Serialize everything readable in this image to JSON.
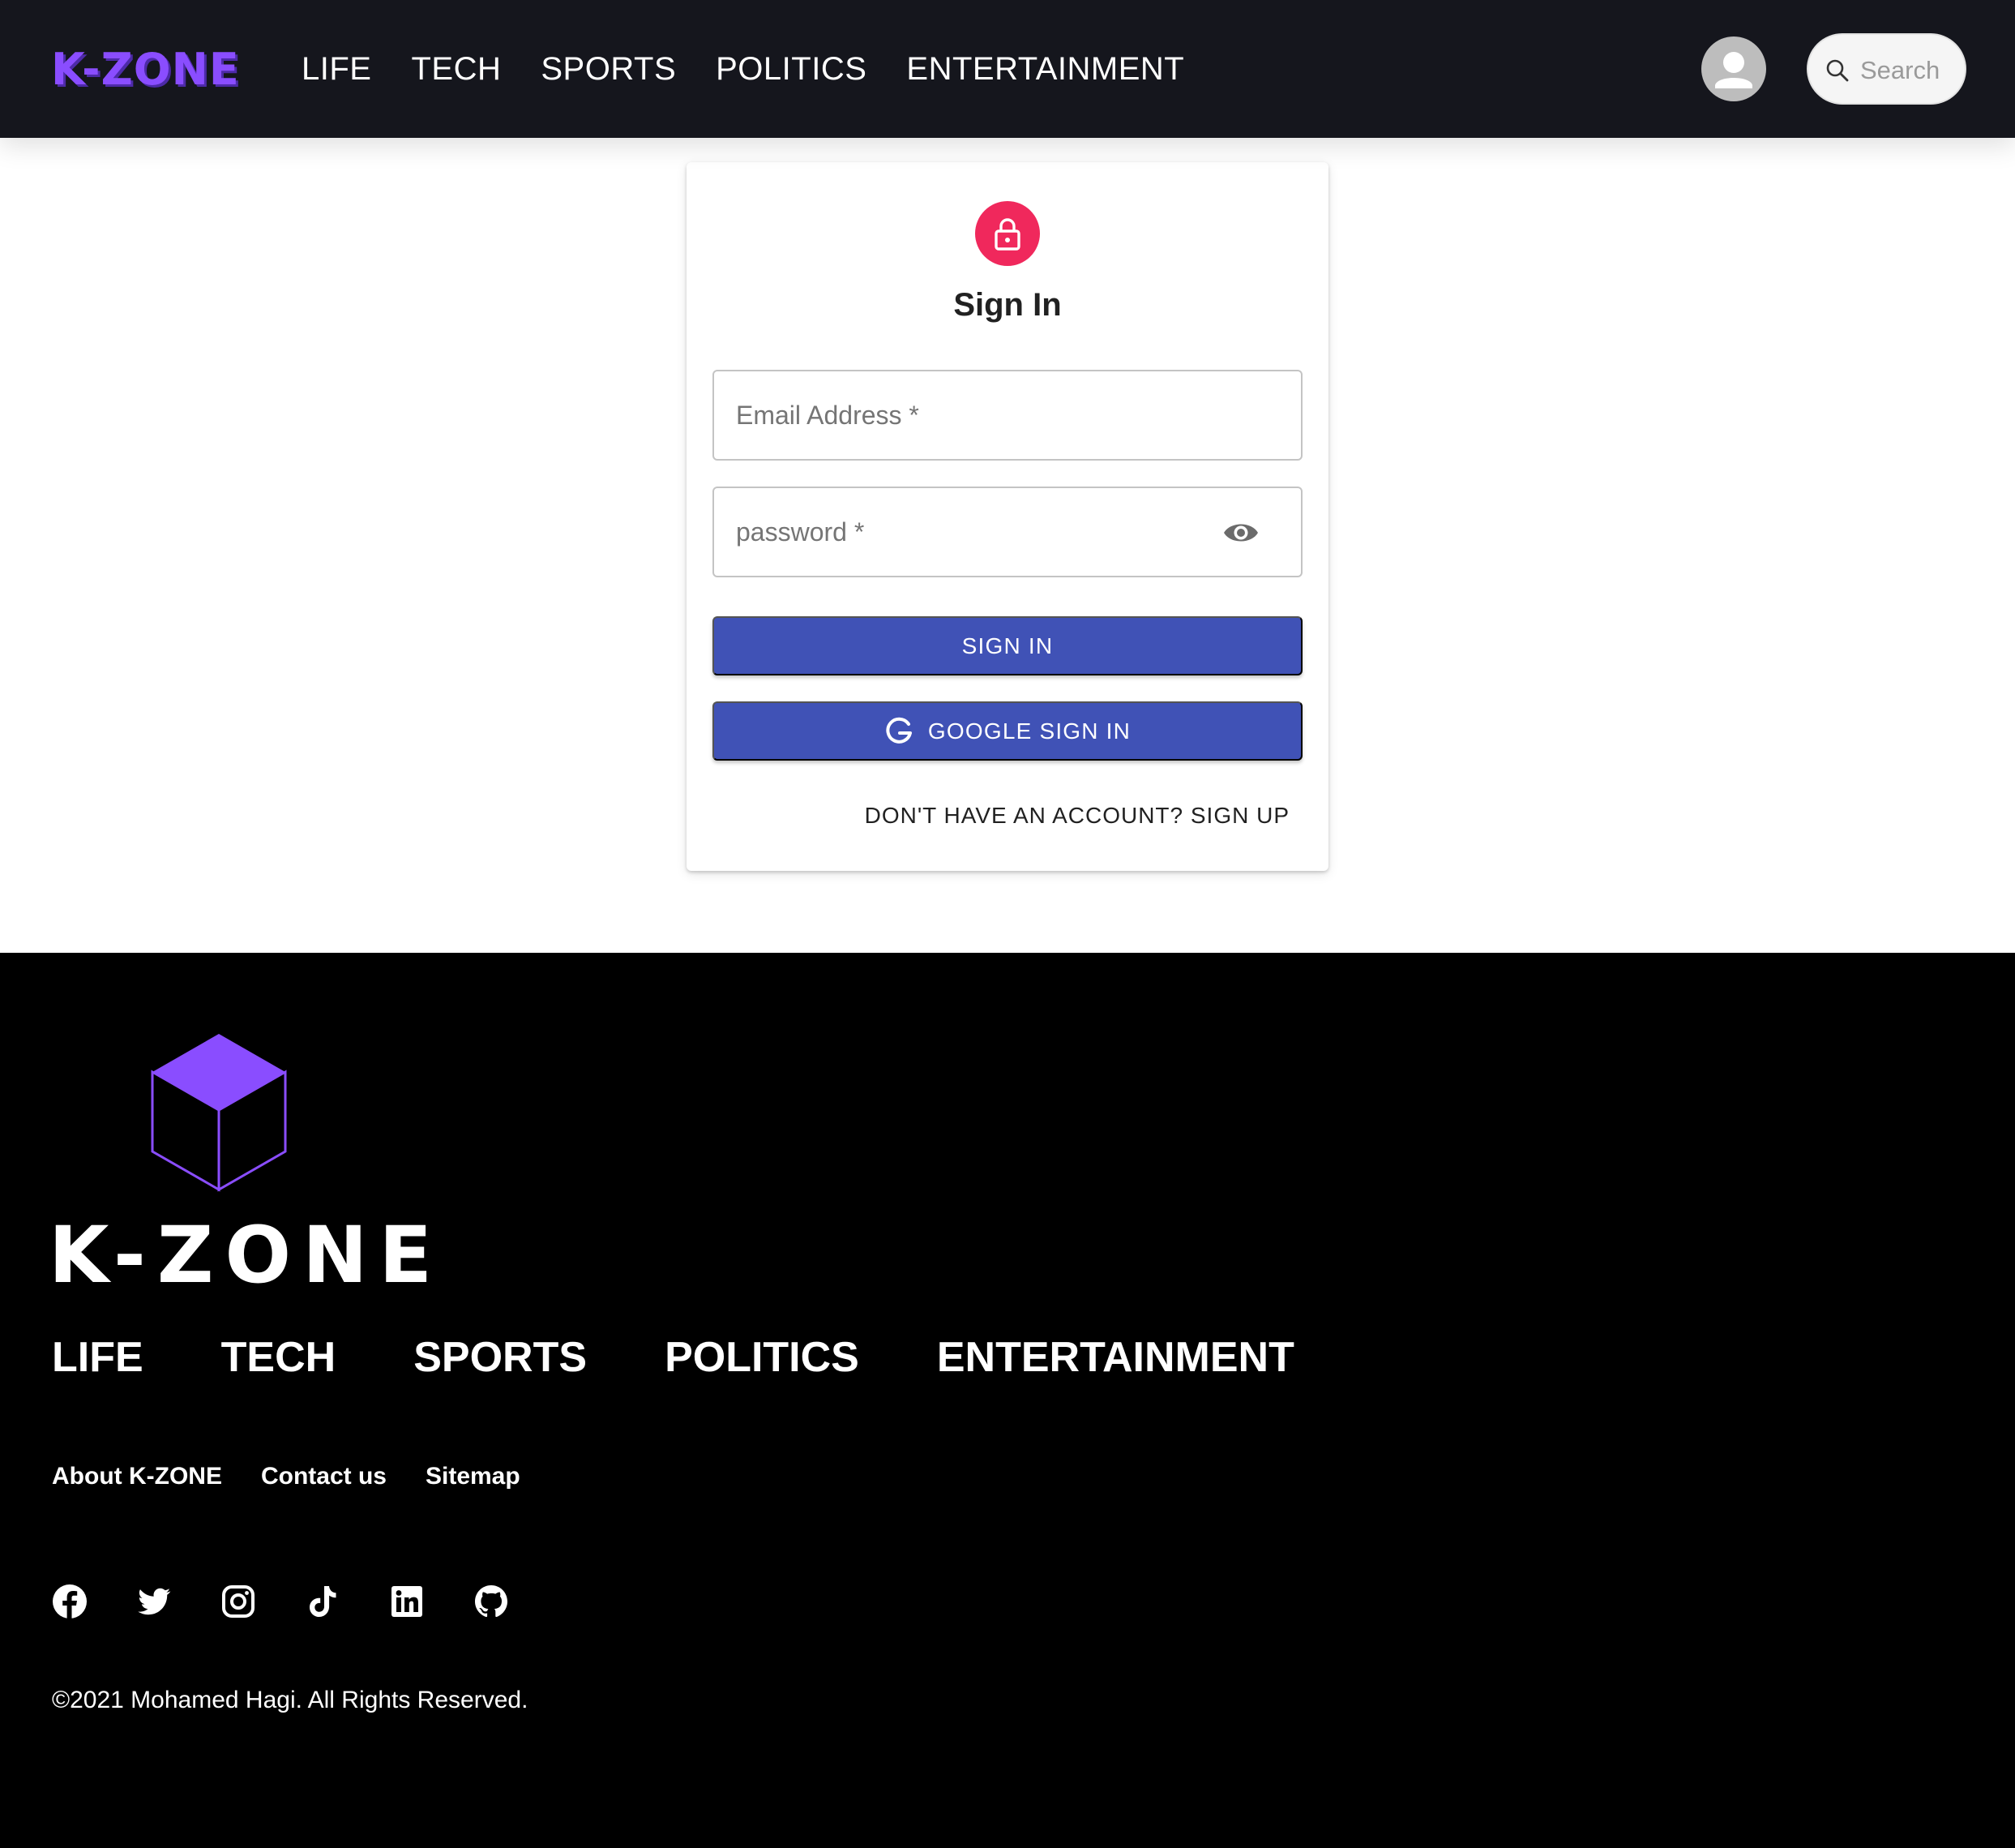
{
  "header": {
    "logo": "K-ZONE",
    "nav": [
      "LIFE",
      "TECH",
      "SPORTS",
      "POLITICS",
      "ENTERTAINMENT"
    ],
    "search_placeholder": "Search",
    "icons": {
      "avatar": "account-circle-icon",
      "search": "search-icon"
    }
  },
  "signin": {
    "title": "Sign In",
    "email_label": "Email Address *",
    "password_label": "password *",
    "signin_button": "SIGN IN",
    "google_button": "GOOGLE SIGN IN",
    "signup_link": "DON'T HAVE AN ACCOUNT? SIGN UP",
    "icons": {
      "lock": "lock-icon",
      "eye": "eye-icon",
      "google": "google-icon"
    }
  },
  "footer": {
    "wordmark": "K-ZONE",
    "nav": [
      "LIFE",
      "TECH",
      "SPORTS",
      "POLITICS",
      "ENTERTAINMENT"
    ],
    "links": [
      "About K-ZONE",
      "Contact us",
      "Sitemap"
    ],
    "socials": [
      "facebook-icon",
      "twitter-icon",
      "instagram-icon",
      "tiktok-icon",
      "linkedin-icon",
      "github-icon"
    ],
    "copyright": "©2021 Mohamed Hagi. All Rights Reserved."
  },
  "colors": {
    "header_bg": "#15161d",
    "accent_purple": "#8a4dff",
    "lock_avatar": "#f0285c",
    "button": "#4052b6",
    "footer_bg": "#000000"
  }
}
